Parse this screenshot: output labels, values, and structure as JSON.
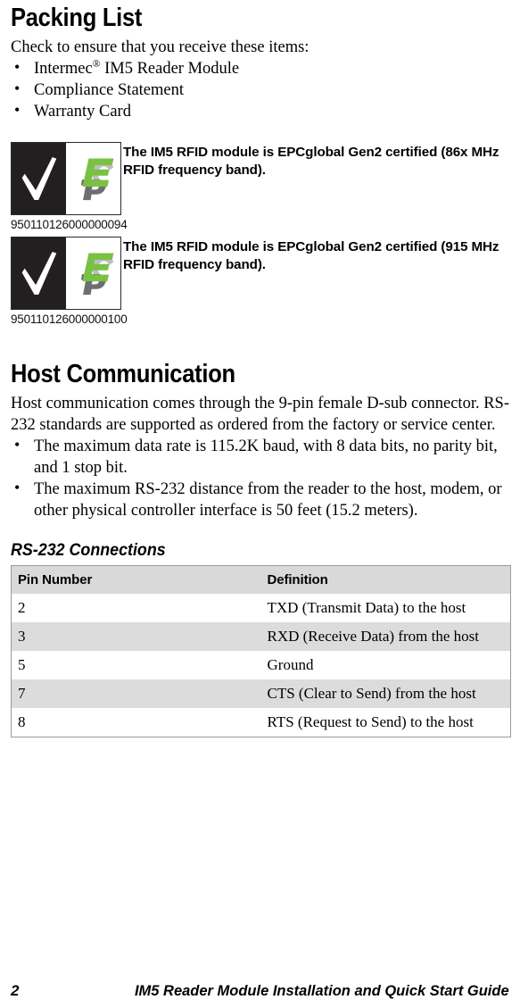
{
  "document": {
    "page_number": "2",
    "footer_title": "IM5 Reader Module Installation and Quick Start Guide"
  },
  "packing_list": {
    "heading": "Packing List",
    "intro": "Check to ensure that you receive these items:",
    "items": [
      {
        "text_before": "Intermec",
        "superscript": "®",
        "text_after": " IM5 Reader Module"
      },
      {
        "text_before": "Compliance Statement",
        "superscript": "",
        "text_after": ""
      },
      {
        "text_before": "Warranty Card",
        "superscript": "",
        "text_after": ""
      }
    ],
    "bullet_glyph": "•"
  },
  "certifications": [
    {
      "logo_name": "epc-global-gen2-certified-mark",
      "number": "950110126000000094",
      "text": "The IM5 RFID module is EPCglobal Gen2 certified (86x MHz RFID frequency band)."
    },
    {
      "logo_name": "epc-global-gen2-certified-mark",
      "number": "950110126000000100",
      "text": "The IM5 RFID module is EPCglobal Gen2 certified (915 MHz RFID frequency band)."
    }
  ],
  "host_communication": {
    "heading": "Host Communication",
    "intro": "Host communication comes through the 9-pin female D-sub connector. RS-232 standards are supported as ordered from the factory or service center.",
    "bullets": [
      "The maximum data rate is 115.2K baud, with 8 data bits, no parity bit, and 1 stop bit.",
      "The maximum RS-232 distance from the reader to the host, modem, or other physical controller interface is 50 feet (15.2 meters)."
    ],
    "bullet_glyph": "•"
  },
  "rs232_table": {
    "caption": "RS-232 Connections",
    "columns": [
      "Pin Number",
      "Definition"
    ],
    "rows": [
      {
        "pin": "2",
        "definition": "TXD (Transmit Data) to the host"
      },
      {
        "pin": "3",
        "definition": "RXD (Receive Data) from the host"
      },
      {
        "pin": "5",
        "definition": "Ground"
      },
      {
        "pin": "7",
        "definition": "CTS (Clear to Send) from the host"
      },
      {
        "pin": "8",
        "definition": "RTS (Request to Send) to the host"
      }
    ]
  },
  "colors": {
    "epc_green": "#7ac143",
    "epc_dark_gray": "#6d6e71",
    "epc_light_gray": "#bcbec0",
    "mark_black": "#231f20",
    "table_header_bg": "#d9d9d9",
    "table_row_shaded_bg": "#dcdcdc",
    "table_border": "#9a9a9a"
  }
}
